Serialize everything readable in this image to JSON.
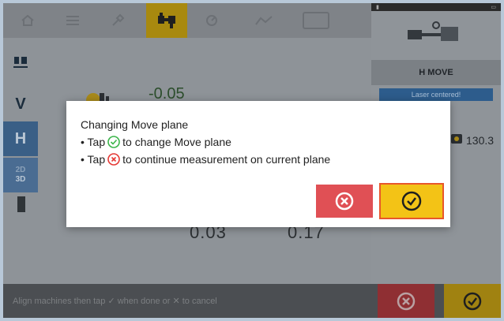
{
  "bottom": {
    "hint": "Align machines then tap ✓ when done or ✕ to cancel"
  },
  "left": {
    "v_label": "V",
    "h_label": "H",
    "mode_2d": "2D",
    "mode_3d": "3D"
  },
  "readings": {
    "top_value": "-0.05",
    "bottom_left": "0.03",
    "bottom_right": "0.17"
  },
  "right_panel": {
    "move_label": "H MOVE",
    "laser_banner": "Laser centered!",
    "reading": "130.3"
  },
  "dialog": {
    "title": "Changing Move plane",
    "line1_prefix": "• Tap",
    "line1_suffix": "to change Move plane",
    "line2_prefix": "• Tap",
    "line2_suffix": "to continue measurement on current plane"
  },
  "colors": {
    "cancel_red": "#e05055",
    "confirm_yellow": "#f3c316",
    "confirm_border": "#e8572a",
    "check_green": "#3bb54a",
    "cross_red": "#e53935",
    "active_tab": "#a8890f"
  },
  "icons": {
    "toolbar": [
      "home-icon",
      "menu-icon",
      "tools-icon",
      "machines-icon",
      "measure-icon",
      "results-icon",
      "frame-icon"
    ],
    "dialog_check": "check-circle-icon",
    "dialog_cross": "cross-circle-icon"
  }
}
